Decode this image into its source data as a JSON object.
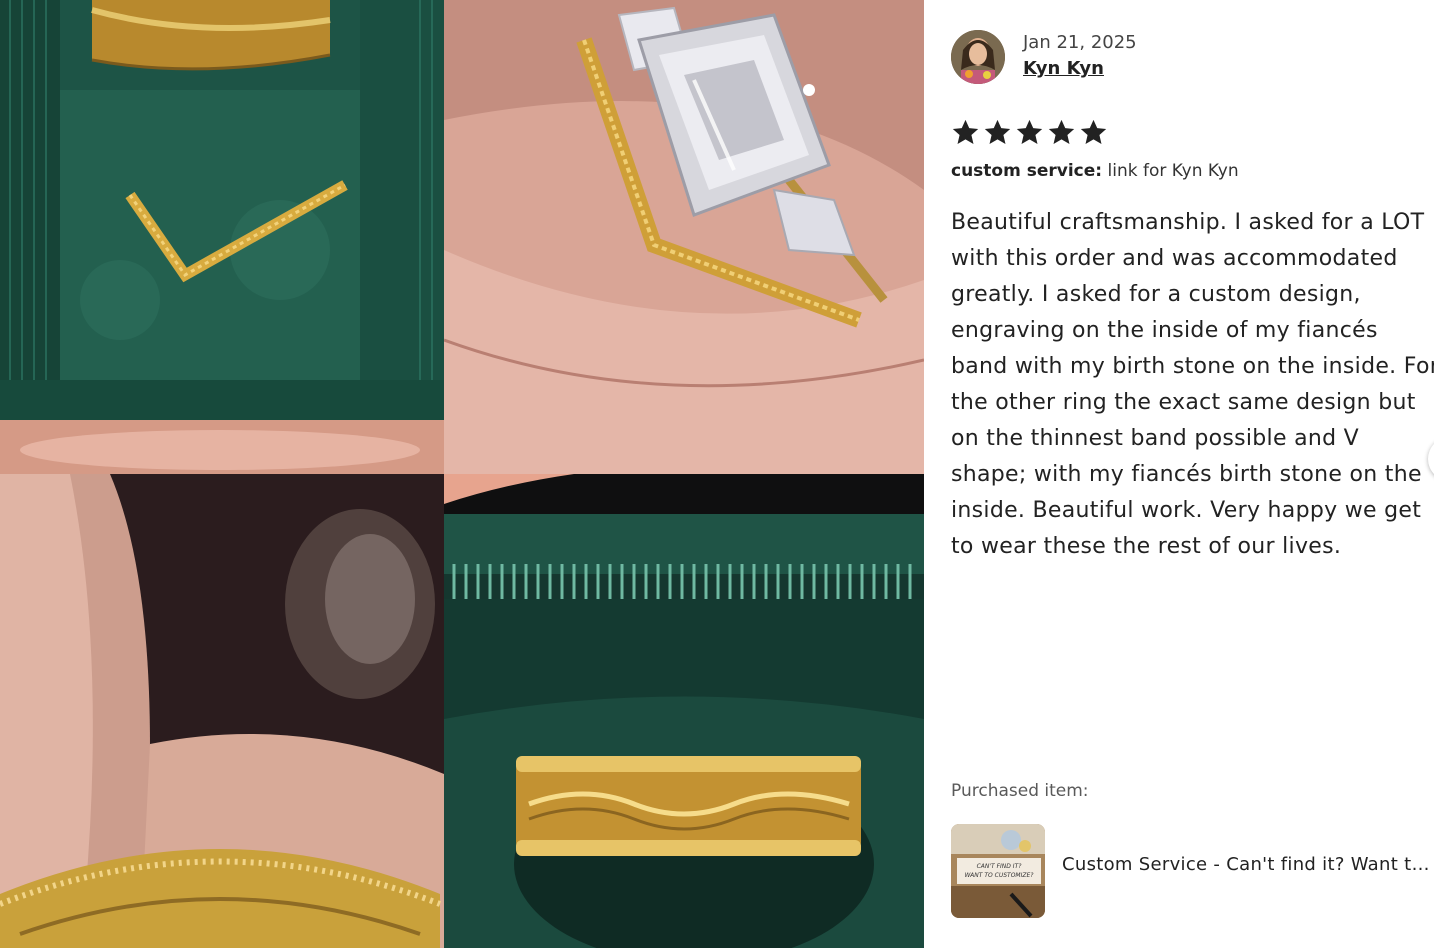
{
  "review": {
    "date": "Jan 21, 2025",
    "reviewer_name": "Kyn Kyn",
    "rating": 5,
    "rating_max": 5,
    "variation_label": "custom service:",
    "variation_value": "link for Kyn Kyn",
    "text": "Beautiful craftsmanship. I asked for a LOT with this order and was accommodated greatly. I asked for a custom design, engraving on the inside of my fiancés band with my birth stone on the inside. For the other ring the exact same design but on the thinnest band possible and V shape; with my fiancés birth stone on the inside. Beautiful work. Very happy we get to wear these the rest of our lives."
  },
  "purchased": {
    "label": "Purchased item:",
    "item_title": "Custom Service - Can't find it? Want to customize?",
    "thumb_text_line1": "CAN'T FIND IT?",
    "thumb_text_line2": "WANT TO CUSTOMIZE?"
  },
  "colors": {
    "star": "#222222",
    "velvet_green": "#1f5a4c",
    "gold": "#c9a13b",
    "skin": "#e8b8a8"
  },
  "icons": {
    "star": "star-icon",
    "next": "chevron-right-icon"
  }
}
